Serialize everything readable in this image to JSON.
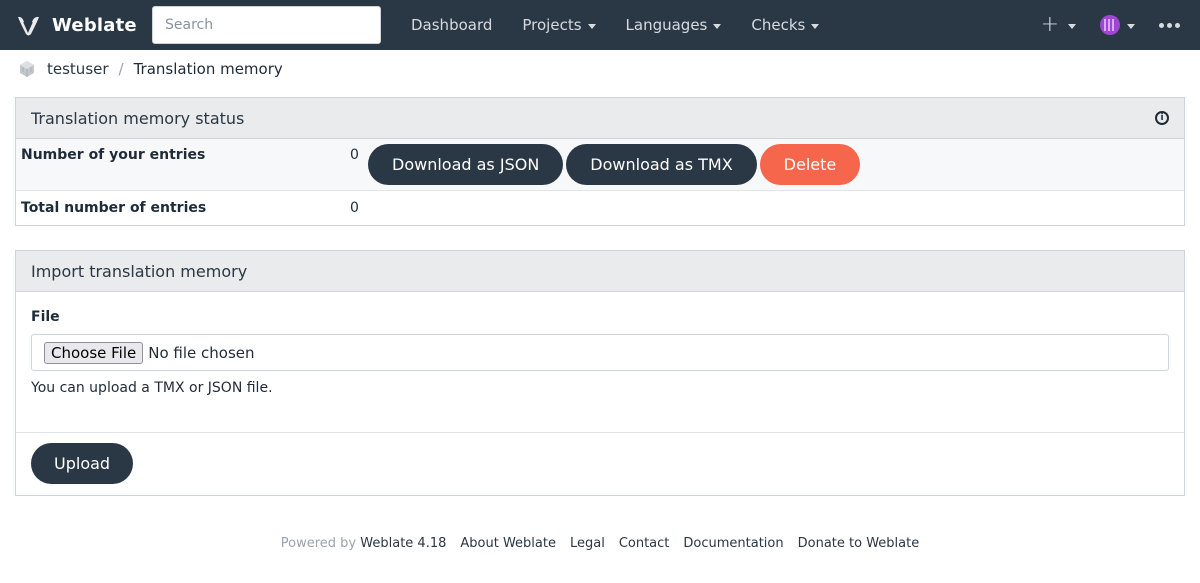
{
  "nav": {
    "brand": "Weblate",
    "search_placeholder": "Search",
    "menu": [
      {
        "label": "Dashboard",
        "dropdown": false
      },
      {
        "label": "Projects",
        "dropdown": true
      },
      {
        "label": "Languages",
        "dropdown": true
      },
      {
        "label": "Checks",
        "dropdown": true
      }
    ],
    "add_icon": "plus-icon",
    "avatar_color": "#a046d6"
  },
  "breadcrumb": {
    "user": "testuser",
    "separator": "/",
    "current": "Translation memory"
  },
  "status_panel": {
    "title": "Translation memory status",
    "rows": [
      {
        "label": "Number of your entries",
        "value": "0"
      },
      {
        "label": "Total number of entries",
        "value": "0"
      }
    ],
    "buttons": {
      "download_json": "Download as JSON",
      "download_tmx": "Download as TMX",
      "delete": "Delete"
    }
  },
  "import_panel": {
    "title": "Import translation memory",
    "file_label": "File",
    "choose_file": "Choose File",
    "no_file": "No file chosen",
    "help": "You can upload a TMX or JSON file.",
    "upload": "Upload"
  },
  "footer": {
    "powered_by": "Powered by",
    "links": [
      "Weblate 4.18",
      "About Weblate",
      "Legal",
      "Contact",
      "Documentation",
      "Donate to Weblate"
    ]
  },
  "colors": {
    "navbar": "#2a3744",
    "primary_button": "#2a3744",
    "danger_button": "#f6664c"
  }
}
